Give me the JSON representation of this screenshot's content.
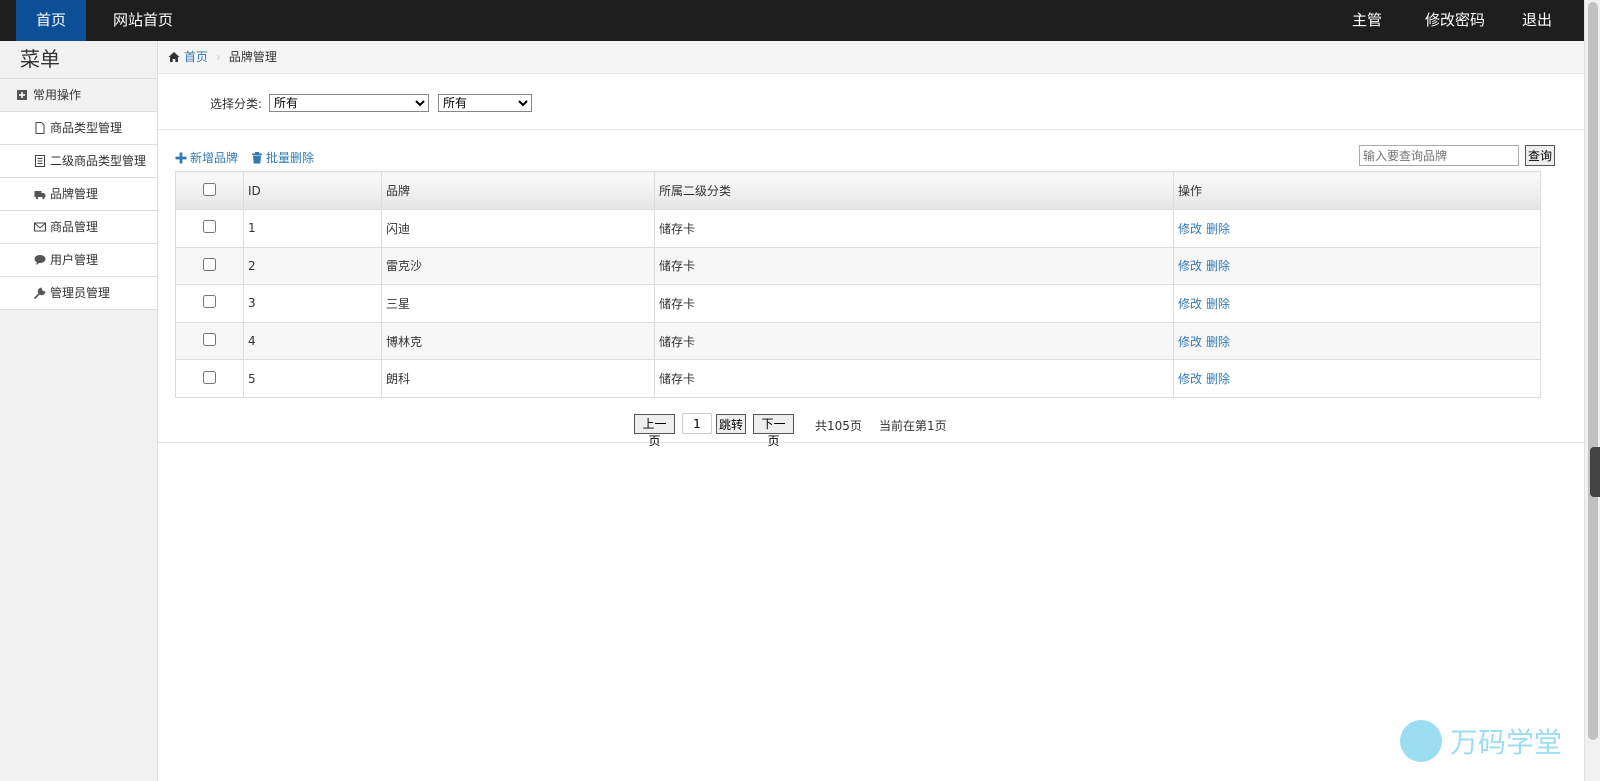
{
  "topnav": {
    "home": "首页",
    "site_home": "网站首页",
    "user": "主管",
    "change_password": "修改密码",
    "logout": "退出"
  },
  "sidebar": {
    "title": "菜单",
    "group": "常用操作",
    "items": [
      {
        "label": "商品类型管理",
        "icon": "file-icon"
      },
      {
        "label": "二级商品类型管理",
        "icon": "list-icon"
      },
      {
        "label": "品牌管理",
        "icon": "truck-icon"
      },
      {
        "label": "商品管理",
        "icon": "envelope-icon"
      },
      {
        "label": "用户管理",
        "icon": "comment-icon"
      },
      {
        "label": "管理员管理",
        "icon": "wrench-icon"
      }
    ]
  },
  "breadcrumb": {
    "home": "首页",
    "current": "品牌管理"
  },
  "filter": {
    "label": "选择分类:",
    "select1": "所有",
    "select2": "所有"
  },
  "toolbar": {
    "add": "新增品牌",
    "batch_delete": "批量删除",
    "search_placeholder": "输入要查询品牌",
    "search_button": "查询"
  },
  "table": {
    "headers": {
      "id": "ID",
      "brand": "品牌",
      "category": "所属二级分类",
      "ops": "操作"
    },
    "rows": [
      {
        "id": "1",
        "brand": "闪迪",
        "category": "储存卡",
        "edit": "修改",
        "delete": "删除"
      },
      {
        "id": "2",
        "brand": "雷克沙",
        "category": "储存卡",
        "edit": "修改",
        "delete": "删除"
      },
      {
        "id": "3",
        "brand": "三星",
        "category": "储存卡",
        "edit": "修改",
        "delete": "删除"
      },
      {
        "id": "4",
        "brand": "博林克",
        "category": "储存卡",
        "edit": "修改",
        "delete": "删除"
      },
      {
        "id": "5",
        "brand": "朗科",
        "category": "储存卡",
        "edit": "修改",
        "delete": "删除"
      }
    ]
  },
  "pager": {
    "prev": "上一页",
    "page_input": "1",
    "jump": "跳转",
    "next": "下一页",
    "total": "共105页",
    "current": "当前在第1页"
  },
  "watermark": "万码学堂",
  "colors": {
    "topbar": "#1e1e1e",
    "active_nav": "#0d4f96",
    "link": "#337ab7"
  }
}
